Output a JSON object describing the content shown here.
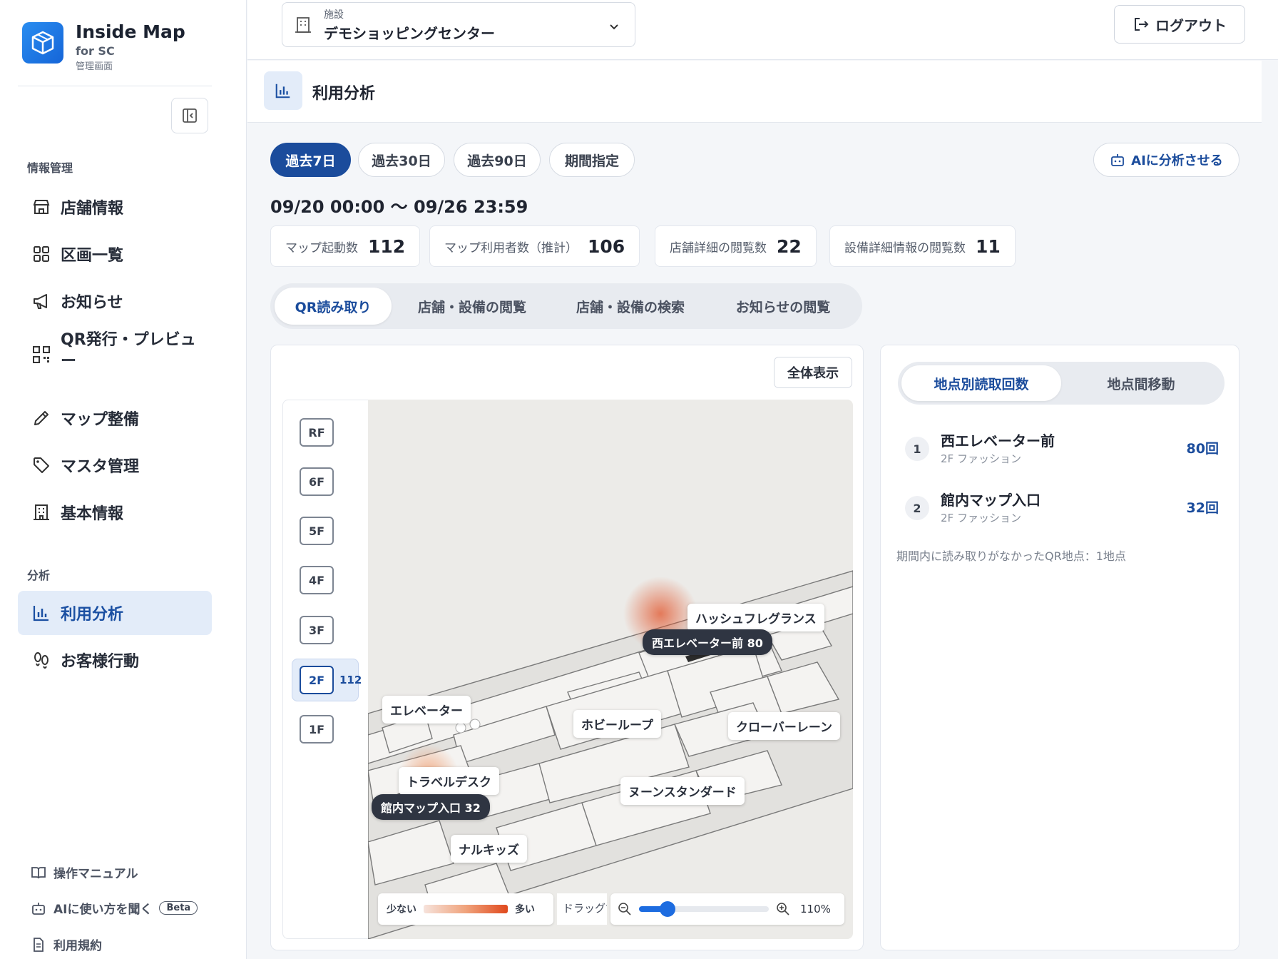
{
  "brand": {
    "title": "Inside Map",
    "subtitle": "for SC",
    "subtitle2": "管理画面"
  },
  "sidebar": {
    "section1": "情報管理",
    "items1": [
      {
        "label": "店舗情報",
        "icon": "store-icon"
      },
      {
        "label": "区画一覧",
        "icon": "grid-icon"
      },
      {
        "label": "お知らせ",
        "icon": "megaphone-icon"
      },
      {
        "label": "QR発行・プレビュー",
        "icon": "qr-icon"
      },
      {
        "label": "マップ整備",
        "icon": "pencil-icon"
      },
      {
        "label": "マスタ管理",
        "icon": "tag-icon"
      },
      {
        "label": "基本情報",
        "icon": "building-icon"
      }
    ],
    "section2": "分析",
    "items2": [
      {
        "label": "利用分析",
        "icon": "bar-chart-icon",
        "active": true
      },
      {
        "label": "お客様行動",
        "icon": "footprints-icon"
      }
    ],
    "footer": [
      {
        "label": "操作マニュアル",
        "icon": "book-icon"
      },
      {
        "label": "AIに使い方を聞く",
        "icon": "robot-icon",
        "badge": "Beta"
      },
      {
        "label": "利用規約",
        "icon": "document-icon"
      }
    ]
  },
  "topbar": {
    "facility_caption": "施設",
    "facility_value": "デモショッピングセンター",
    "logout_label": "ログアウト"
  },
  "page": {
    "title": "利用分析"
  },
  "periods": [
    {
      "label": "過去7日",
      "active": true
    },
    {
      "label": "過去30日",
      "active": false
    },
    {
      "label": "過去90日",
      "active": false
    },
    {
      "label": "期間指定",
      "active": false
    }
  ],
  "ai_button": "AIに分析させる",
  "date_range": "09/20 00:00 〜 09/26 23:59",
  "stats": [
    {
      "label": "マップ起動数",
      "value": "112"
    },
    {
      "label": "マップ利用者数（推計）",
      "value": "106"
    },
    {
      "label": "店舗詳細の閲覧数",
      "value": "22"
    },
    {
      "label": "設備詳細情報の閲覧数",
      "value": "11"
    }
  ],
  "tabs": [
    {
      "label": "QR読み取り",
      "active": true
    },
    {
      "label": "店舗・設備の閲覧",
      "active": false
    },
    {
      "label": "店舗・設備の検索",
      "active": false
    },
    {
      "label": "お知らせの閲覧",
      "active": false
    }
  ],
  "map": {
    "fit_button": "全体表示",
    "floors": [
      "RF",
      "6F",
      "5F",
      "4F",
      "3F",
      "2F",
      "1F"
    ],
    "selected_floor": "2F",
    "selected_floor_count": "112",
    "labels": {
      "hash": "ハッシュフレグランス",
      "west_elev": "西エレベーター前 80",
      "elevator": "エレベーター",
      "hobby": "ホビーループ",
      "clover": "クローバーレーン",
      "travel": "トラベルデスク",
      "map_entrance": "館内マップ入口 32",
      "noon": "ヌーンスタンダード",
      "naru": "ナルキッズ"
    },
    "legend_low": "少ない",
    "legend_high": "多い",
    "drag_hint": "ドラッグで移動",
    "zoom_level": "110%",
    "zoom_value": 0.22,
    "heat_color": "#e0491d"
  },
  "right": {
    "subtabs": [
      {
        "label": "地点別読取回数",
        "active": true
      },
      {
        "label": "地点間移動",
        "active": false
      }
    ],
    "ranking": [
      {
        "rank": "1",
        "name": "西エレベーター前",
        "sub": "2F ファッション",
        "count": "80回"
      },
      {
        "rank": "2",
        "name": "館内マップ入口",
        "sub": "2F ファッション",
        "count": "32回"
      }
    ],
    "note": "期間内に読み取りがなかったQR地点：1地点"
  },
  "colors": {
    "accent": "#1b4c9c",
    "active_bg": "#e3ecf9",
    "brand": "#1565d8"
  }
}
